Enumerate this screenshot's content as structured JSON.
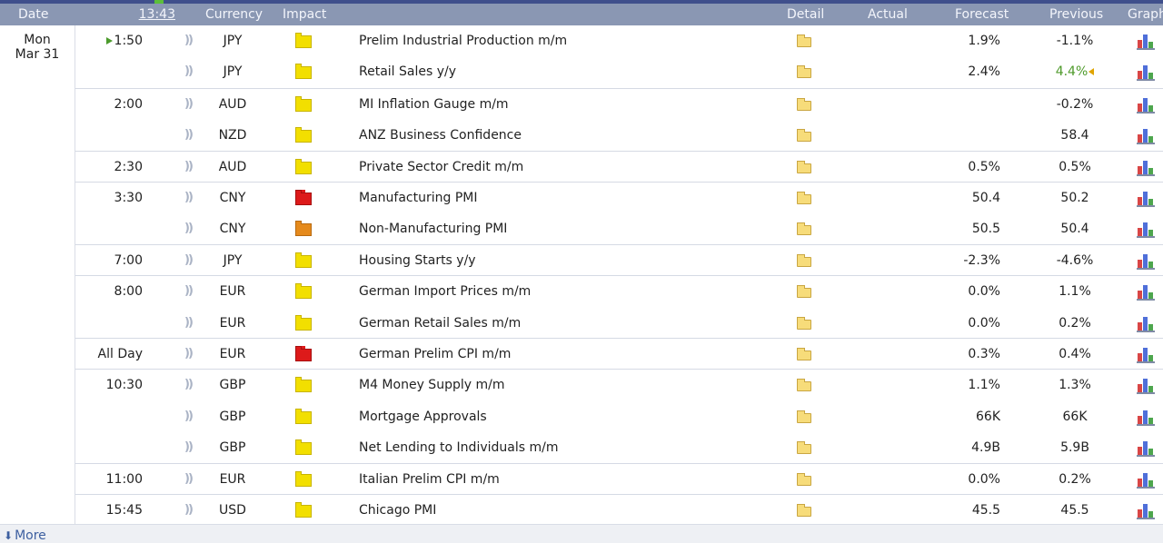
{
  "header": {
    "date": "Date",
    "time": "13:43",
    "currency": "Currency",
    "impact": "Impact",
    "detail": "Detail",
    "actual": "Actual",
    "forecast": "Forecast",
    "previous": "Previous",
    "graph": "Graph"
  },
  "day": {
    "weekday": "Mon",
    "date": "Mar 31"
  },
  "groups": [
    {
      "time": "1:50",
      "current": true,
      "events": [
        {
          "currency": "JPY",
          "impact": "low",
          "event": "Prelim Industrial Production m/m",
          "forecast": "1.9%",
          "previous": "-1.1%"
        },
        {
          "currency": "JPY",
          "impact": "low",
          "event": "Retail Sales y/y",
          "forecast": "2.4%",
          "previous": "4.4%",
          "revised": true
        }
      ]
    },
    {
      "time": "2:00",
      "events": [
        {
          "currency": "AUD",
          "impact": "low",
          "event": "MI Inflation Gauge m/m",
          "forecast": "",
          "previous": "-0.2%"
        },
        {
          "currency": "NZD",
          "impact": "low",
          "event": "ANZ Business Confidence",
          "forecast": "",
          "previous": "58.4"
        }
      ]
    },
    {
      "time": "2:30",
      "events": [
        {
          "currency": "AUD",
          "impact": "low",
          "event": "Private Sector Credit m/m",
          "forecast": "0.5%",
          "previous": "0.5%"
        }
      ]
    },
    {
      "time": "3:30",
      "events": [
        {
          "currency": "CNY",
          "impact": "high",
          "event": "Manufacturing PMI",
          "forecast": "50.4",
          "previous": "50.2"
        },
        {
          "currency": "CNY",
          "impact": "medium",
          "event": "Non-Manufacturing PMI",
          "forecast": "50.5",
          "previous": "50.4"
        }
      ]
    },
    {
      "time": "7:00",
      "events": [
        {
          "currency": "JPY",
          "impact": "low",
          "event": "Housing Starts y/y",
          "forecast": "-2.3%",
          "previous": "-4.6%"
        }
      ]
    },
    {
      "time": "8:00",
      "events": [
        {
          "currency": "EUR",
          "impact": "low",
          "event": "German Import Prices m/m",
          "forecast": "0.0%",
          "previous": "1.1%"
        },
        {
          "currency": "EUR",
          "impact": "low",
          "event": "German Retail Sales m/m",
          "forecast": "0.0%",
          "previous": "0.2%"
        }
      ]
    },
    {
      "time": "All Day",
      "events": [
        {
          "currency": "EUR",
          "impact": "high",
          "event": "German Prelim CPI m/m",
          "forecast": "0.3%",
          "previous": "0.4%"
        }
      ]
    },
    {
      "time": "10:30",
      "events": [
        {
          "currency": "GBP",
          "impact": "low",
          "event": "M4 Money Supply m/m",
          "forecast": "1.1%",
          "previous": "1.3%"
        },
        {
          "currency": "GBP",
          "impact": "low",
          "event": "Mortgage Approvals",
          "forecast": "66K",
          "previous": "66K"
        },
        {
          "currency": "GBP",
          "impact": "low",
          "event": "Net Lending to Individuals m/m",
          "forecast": "4.9B",
          "previous": "5.9B"
        }
      ]
    },
    {
      "time": "11:00",
      "events": [
        {
          "currency": "EUR",
          "impact": "low",
          "event": "Italian Prelim CPI m/m",
          "forecast": "0.0%",
          "previous": "0.2%"
        }
      ]
    },
    {
      "time": "15:45",
      "events": [
        {
          "currency": "USD",
          "impact": "low",
          "event": "Chicago PMI",
          "forecast": "45.5",
          "previous": "45.5"
        }
      ]
    }
  ],
  "footer": {
    "more": "More"
  },
  "colors": {
    "header_bg": "#8a97b3",
    "low_impact": "#f2df00",
    "medium_impact": "#e58a1c",
    "high_impact": "#dd1a1a",
    "better_than_expected": "#4e9a2a"
  }
}
